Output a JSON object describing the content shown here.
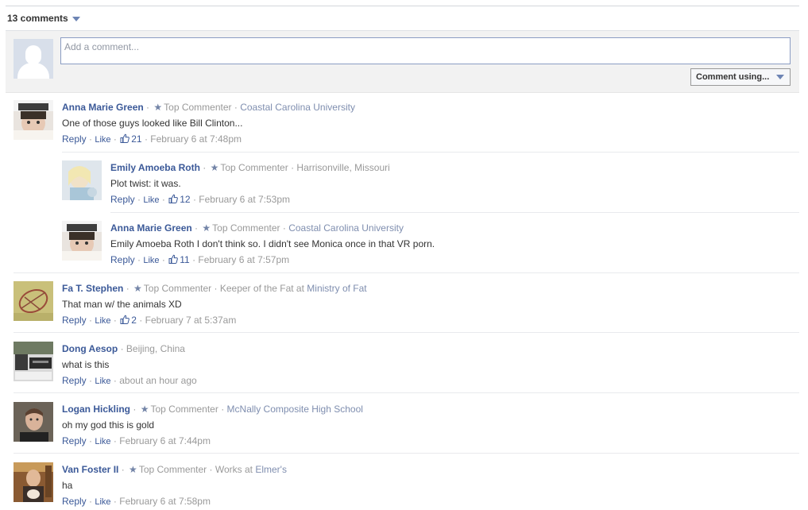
{
  "header": {
    "count": "13 comments"
  },
  "composer": {
    "placeholder": "Add a comment...",
    "comment_using": "Comment using..."
  },
  "sep": "·",
  "reply_label": "Reply",
  "like_label": "Like",
  "comments": [
    {
      "name": "Anna Marie Green",
      "badge": "Top Commenter",
      "info": "Coastal Carolina University",
      "text": "One of those guys looked like Bill Clinton...",
      "likes": "21",
      "time": "February 6 at 7:48pm"
    },
    {
      "name": "Emily Amoeba Roth",
      "badge": "Top Commenter",
      "info": "Harrisonville, Missouri",
      "text": "Plot twist: it was.",
      "likes": "12",
      "time": "February 6 at 7:53pm"
    },
    {
      "name": "Anna Marie Green",
      "badge": "Top Commenter",
      "info": "Coastal Carolina University",
      "text": "Emily Amoeba Roth I don't think so. I didn't see Monica once in that VR porn.",
      "likes": "11",
      "time": "February 6 at 7:57pm"
    },
    {
      "name": "Fa T. Stephen",
      "badge": "Top Commenter",
      "info_prefix": "Keeper of the Fat at",
      "info": "Ministry of Fat",
      "text": "That man w/ the animals XD",
      "likes": "2",
      "time": "February 7 at 5:37am"
    },
    {
      "name": "Dong Aesop",
      "info": "Beijing, China",
      "text": "what is this",
      "time": "about an hour ago"
    },
    {
      "name": "Logan Hickling",
      "badge": "Top Commenter",
      "info": "McNally Composite High School",
      "text": "oh my god this is gold",
      "time": "February 6 at 7:44pm"
    },
    {
      "name": "Van Foster II",
      "badge": "Top Commenter",
      "info_prefix": "Works at",
      "info": "Elmer's",
      "text": "ha",
      "time": "February 6 at 7:58pm"
    }
  ],
  "colors": {
    "link": "#3b5998",
    "muted": "#999999",
    "composer_bg": "#f2f2f2"
  }
}
